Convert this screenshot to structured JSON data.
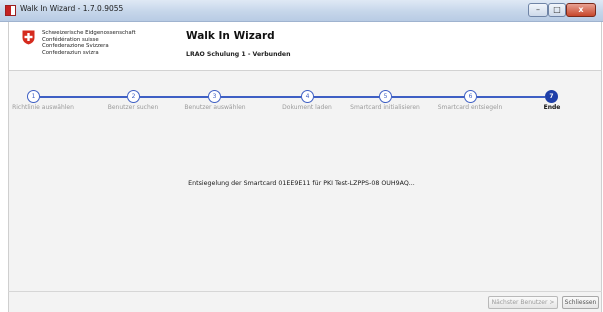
{
  "window": {
    "title": "Walk In Wizard - 1.7.0.9055",
    "controls": [
      "–",
      "□",
      "x"
    ]
  },
  "header": {
    "org_lines": [
      "Schweizerische Eidgenossenschaft",
      "Confédération suisse",
      "Confederazione Svizzera",
      "Confederaziun svizra"
    ],
    "title": "Walk In Wizard",
    "subtitle": "LRAO Schulung 1 - Verbunden"
  },
  "steps": [
    {
      "number": "1",
      "label": "Richtlinie auswählen",
      "state": "done"
    },
    {
      "number": "2",
      "label": "Benutzer suchen",
      "state": "done"
    },
    {
      "number": "3",
      "label": "Benutzer auswählen",
      "state": "done"
    },
    {
      "number": "4",
      "label": "Dokument laden",
      "state": "done"
    },
    {
      "number": "5",
      "label": "Smartcard initialisieren",
      "state": "done"
    },
    {
      "number": "6",
      "label": "Smartcard entsiegeln",
      "state": "done"
    },
    {
      "number": "7",
      "label": "Ende",
      "state": "active"
    }
  ],
  "status_message": "Entsiegelung der Smartcard 01EE9E11 für PKI Test-LZPPS-08 OUH9AQ...",
  "footer": {
    "next_button": "Nächster Benutzer >",
    "close_button": "Schliessen"
  },
  "colors": {
    "accent": "#3e5fc4",
    "active_step": "#1f3fa8",
    "swiss_red": "#d52b1e"
  }
}
